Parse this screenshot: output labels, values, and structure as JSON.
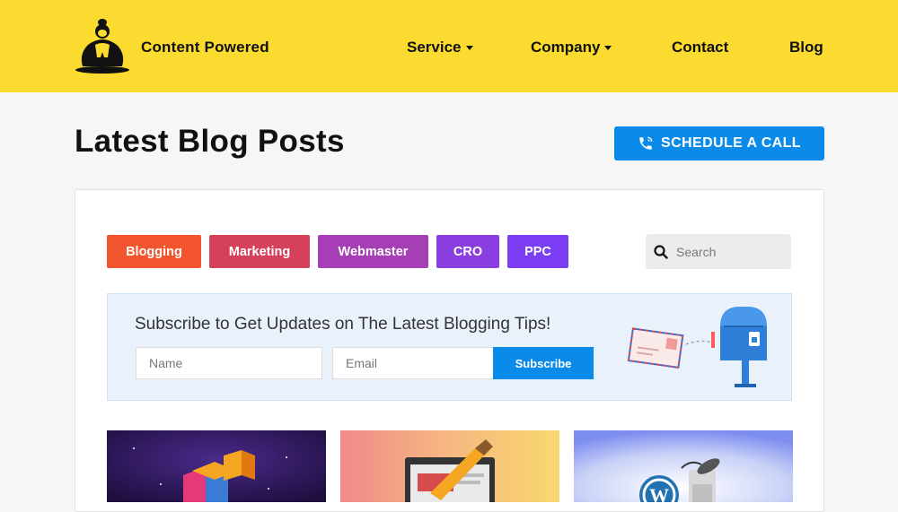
{
  "header": {
    "brand": "Content Powered",
    "nav": [
      {
        "label": "Service",
        "has_dropdown": true
      },
      {
        "label": "Company",
        "has_dropdown": true
      },
      {
        "label": "Contact",
        "has_dropdown": false
      },
      {
        "label": "Blog",
        "has_dropdown": false
      }
    ],
    "logo_icon": "sumo-wrestler-logo"
  },
  "main": {
    "title": "Latest Blog Posts",
    "cta": {
      "label": "SCHEDULE A CALL",
      "icon": "phone-icon"
    }
  },
  "filters": {
    "tags": [
      {
        "label": "Blogging",
        "color": "#f2542d"
      },
      {
        "label": "Marketing",
        "color": "#d5405b"
      },
      {
        "label": "Webmaster",
        "color": "#a63fb5"
      },
      {
        "label": "CRO",
        "color": "#8b3ee0"
      },
      {
        "label": "PPC",
        "color": "#7a3df4"
      }
    ],
    "search": {
      "placeholder": "Search",
      "icon": "search-icon"
    }
  },
  "subscribe": {
    "heading": "Subscribe to Get Updates on The Latest Blogging Tips!",
    "name_placeholder": "Name",
    "email_placeholder": "Email",
    "button_label": "Subscribe",
    "illustration": "mailbox-illustration"
  },
  "posts": [
    {
      "thumbnail": "3d-blocks-thumbnail"
    },
    {
      "thumbnail": "paint-brush-browser-thumbnail"
    },
    {
      "thumbnail": "wordpress-trash-thumbnail"
    }
  ],
  "colors": {
    "header_bg": "#fbdb2f",
    "accent": "#0a8bea",
    "page_bg": "#f6f6f6",
    "subscribe_bg": "#e9f2fb"
  }
}
